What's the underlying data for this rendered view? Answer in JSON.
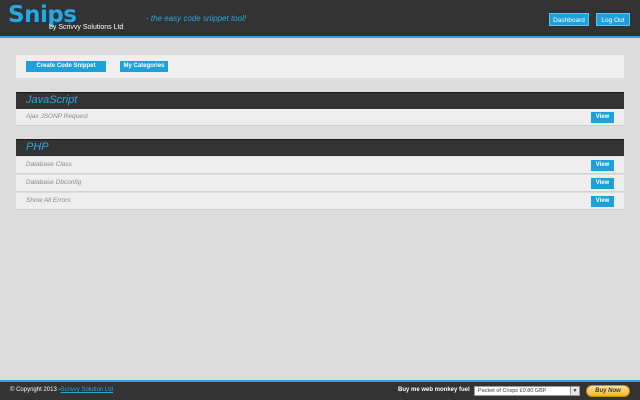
{
  "header": {
    "logo": "Snips",
    "byline": "by Scrivvy Solutions Ltd",
    "tagline": "- the easy code snippet tool!",
    "dashboard_label": "Dashboard",
    "logout_label": "Log Out"
  },
  "toolbar": {
    "create_label": "Create Code Snippet",
    "categories_label": "My Categories"
  },
  "categories": [
    {
      "title": "JavaScript",
      "snippets": [
        {
          "label": "Ajax JSONP Request",
          "action": "View"
        }
      ]
    },
    {
      "title": "PHP",
      "snippets": [
        {
          "label": "Database Class",
          "action": "View"
        },
        {
          "label": "Database Dbconfig",
          "action": "View"
        },
        {
          "label": "Show All Errors",
          "action": "View"
        }
      ]
    }
  ],
  "footer": {
    "copyright": "© Copyright 2013 -",
    "company_link": "Scrivvy Solution Ltd",
    "fuel_label": "Buy me web monkey fuel",
    "fuel_option": "Packet of Crisps £0.80 GBP",
    "buy_now": "Buy Now"
  },
  "colors": {
    "accent": "#29a8e0",
    "dark": "#333333",
    "background": "#dcdcdc"
  }
}
